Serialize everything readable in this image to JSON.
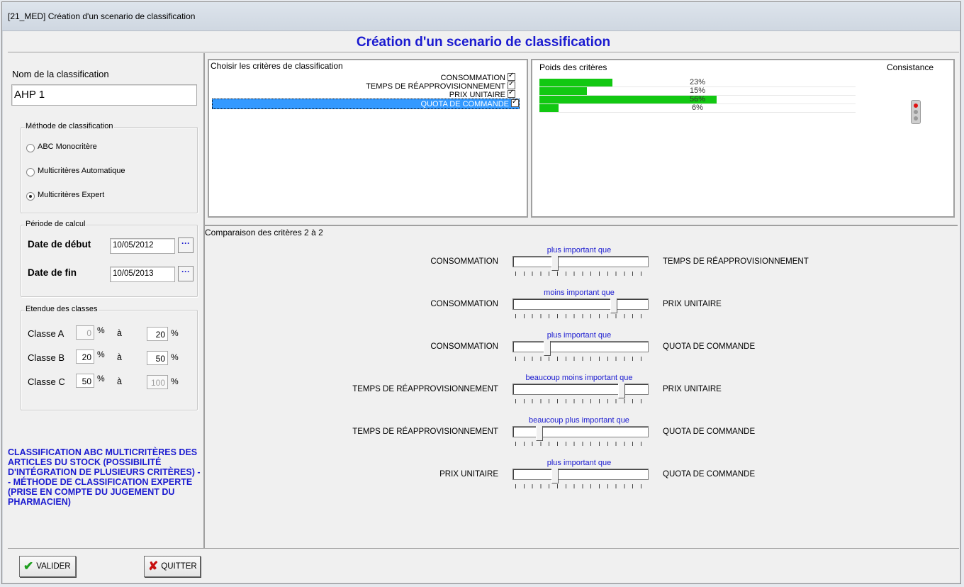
{
  "window": {
    "title": "[21_MED] Création d'un scenario de classification"
  },
  "header": {
    "title": "Création d'un scenario de classification"
  },
  "left": {
    "name_label": "Nom de la classification",
    "name_value": "AHP 1",
    "method": {
      "legend": "Méthode de classification",
      "options": [
        {
          "label": "ABC Monocritère",
          "selected": false
        },
        {
          "label": "Multicritères Automatique",
          "selected": false
        },
        {
          "label": "Multicritères Expert",
          "selected": true
        }
      ]
    },
    "period": {
      "legend": "Période de calcul",
      "start_label": "Date de début",
      "start_value": "10/05/2012",
      "end_label": "Date de  fin",
      "end_value": "10/05/2013",
      "picker_glyph": "···"
    },
    "classes": {
      "legend": "Etendue des classes",
      "rows": [
        {
          "label": "Classe A",
          "from": "0",
          "pct": "%",
          "a": "à",
          "to": "20",
          "from_disabled": true,
          "to_disabled": false
        },
        {
          "label": "Classe B",
          "from": "20",
          "pct": "%",
          "a": "à",
          "to": "50",
          "from_disabled": false,
          "to_disabled": false
        },
        {
          "label": "Classe C",
          "from": "50",
          "pct": "%",
          "a": "à",
          "to": "100",
          "from_disabled": false,
          "to_disabled": true
        }
      ]
    },
    "description": "CLASSIFICATION ABC MULTICRITÈRES DES ARTICLES DU STOCK (POSSIBILITÉ D'INTÉGRATION DE PLUSIEURS CRITÈRES) -- MÉTHODE DE CLASSIFICATION EXPERTE (PRISE EN COMPTE DU JUGEMENT DU PHARMACIEN)"
  },
  "criteria_panel": {
    "title": "Choisir les critères de classification",
    "items": [
      {
        "label": "CONSOMMATION",
        "checked": true,
        "selected": false
      },
      {
        "label": "TEMPS DE RÉAPPROVISIONNEMENT",
        "checked": true,
        "selected": false
      },
      {
        "label": "PRIX UNITAIRE",
        "checked": true,
        "selected": false
      },
      {
        "label": "QUOTA DE COMMANDE",
        "checked": true,
        "selected": true
      }
    ]
  },
  "weights_panel": {
    "title": "Poids des critères",
    "consistency_label": "Consistance",
    "bars": [
      {
        "label": "23%",
        "value": 0.23
      },
      {
        "label": "15%",
        "value": 0.15
      },
      {
        "label": "56%",
        "value": 0.56
      },
      {
        "label": "6%",
        "value": 0.06
      }
    ],
    "fill_color": "#12c812"
  },
  "comparison": {
    "title": "Comparaison des critères 2 à 2",
    "rows": [
      {
        "left": "CONSOMMATION",
        "right": "TEMPS DE RÉAPPROVISIONNEMENT",
        "caption": "plus important que",
        "level": 0.3
      },
      {
        "left": "CONSOMMATION",
        "right": "PRIX UNITAIRE",
        "caption": "moins important que",
        "level": 0.76
      },
      {
        "left": "CONSOMMATION",
        "right": "QUOTA DE COMMANDE",
        "caption": "plus important que",
        "level": 0.24
      },
      {
        "left": "TEMPS DE RÉAPPROVISIONNEMENT",
        "right": "PRIX UNITAIRE",
        "caption": "beaucoup moins important que",
        "level": 0.82
      },
      {
        "left": "TEMPS DE RÉAPPROVISIONNEMENT",
        "right": "QUOTA DE COMMANDE",
        "caption": "beaucoup plus important que",
        "level": 0.18
      },
      {
        "left": "PRIX UNITAIRE",
        "right": "QUOTA DE COMMANDE",
        "caption": "plus important que",
        "level": 0.3
      }
    ]
  },
  "footer": {
    "validate_label": "VALIDER",
    "quit_label": "QUITTER",
    "validate_icon": "checkmark-icon",
    "quit_icon": "x-icon"
  }
}
